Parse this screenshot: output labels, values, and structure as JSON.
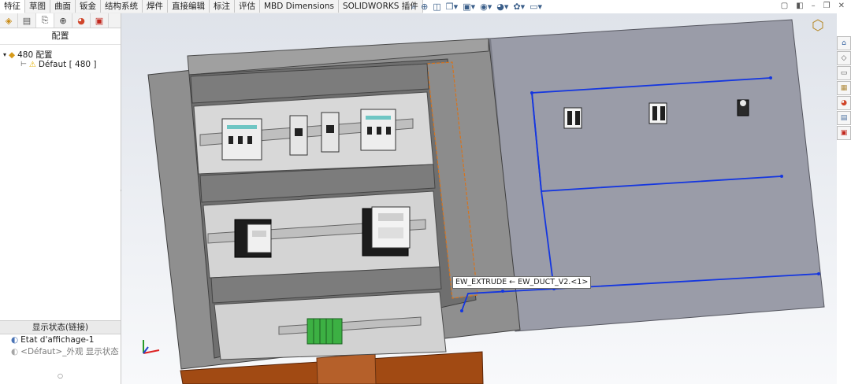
{
  "tabs": [
    "特征",
    "草图",
    "曲面",
    "钣金",
    "结构系统",
    "焊件",
    "直接编辑",
    "标注",
    "评估",
    "MBD Dimensions",
    "SOLIDWORKS 插件"
  ],
  "panel": {
    "title": "配置",
    "tree_root": "480 配置",
    "tree_child": "Défaut [ 480 ]",
    "display_section_title": "显示状态(链接)",
    "display_states": [
      "Etat d'affichage-1",
      "<Défaut>_外观 显示状态"
    ]
  },
  "tooltip": "EW_EXTRUDE ← EW_DUCT_V2.<1>",
  "colors": {
    "wire": "#1436e0",
    "cabinet": "#8f8f8f",
    "door": "#9a9ca8",
    "background_top": "#dfe3ea",
    "background_bottom": "#f8f9fb",
    "floor": "#a14a13"
  },
  "icons": [
    "search-icon",
    "zoom-area-icon",
    "section-view-icon",
    "view-orientation-icon",
    "display-style-icon",
    "hide-show-icon",
    "appearance-icon",
    "scene-icon",
    "monitor-icon",
    "home-icon",
    "part-icon",
    "folder-icon",
    "view-palette-icon",
    "appearance-palette-icon",
    "custom-properties-icon",
    "toolbox-icon"
  ]
}
